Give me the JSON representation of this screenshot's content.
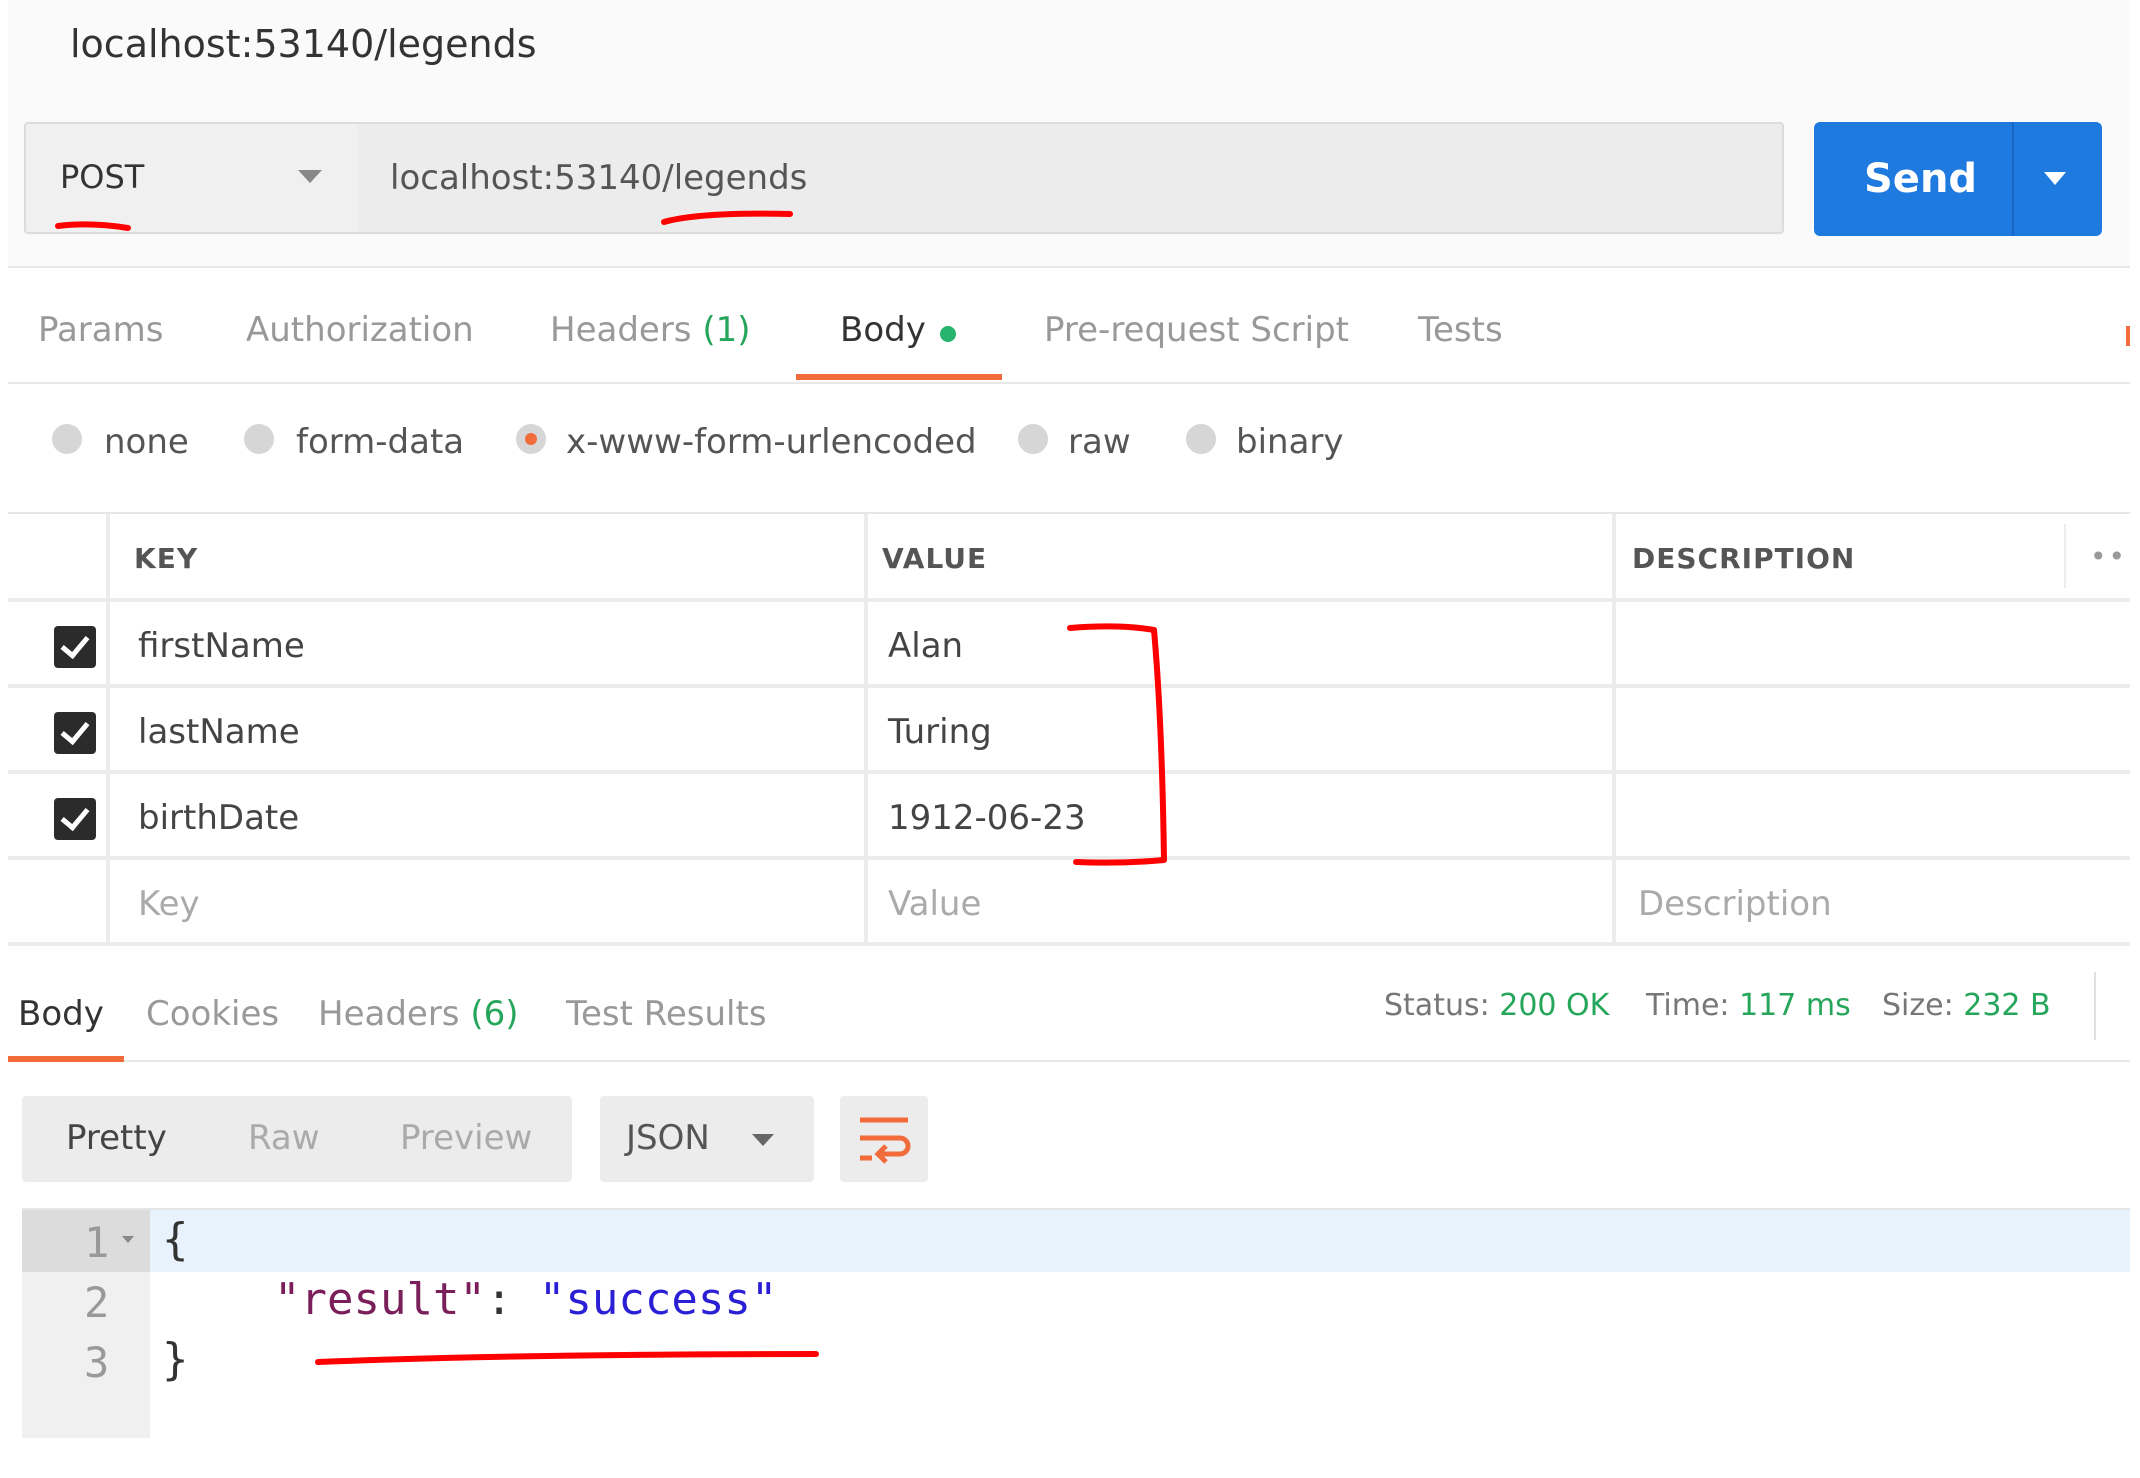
{
  "window": {
    "title": "localhost:53140/legends"
  },
  "request": {
    "method": "POST",
    "url": "localhost:53140/legends",
    "send_label": "Send"
  },
  "request_tabs": {
    "params": "Params",
    "authorization": "Authorization",
    "headers": "Headers",
    "headers_count": "(1)",
    "body": "Body",
    "pre_request": "Pre-request Script",
    "tests": "Tests"
  },
  "body_modes": [
    "none",
    "form-data",
    "x-www-form-urlencoded",
    "raw",
    "binary"
  ],
  "body_mode_selected": "x-www-form-urlencoded",
  "params_table": {
    "columns": [
      "KEY",
      "VALUE",
      "DESCRIPTION"
    ],
    "rows": [
      {
        "key": "firstName",
        "value": "Alan",
        "description": "",
        "checked": true
      },
      {
        "key": "lastName",
        "value": "Turing",
        "description": "",
        "checked": true
      },
      {
        "key": "birthDate",
        "value": "1912-06-23",
        "description": "",
        "checked": true
      }
    ],
    "placeholders": {
      "key": "Key",
      "value": "Value",
      "description": "Description"
    }
  },
  "response_tabs": {
    "body": "Body",
    "cookies": "Cookies",
    "headers": "Headers",
    "headers_count": "(6)",
    "test_results": "Test Results"
  },
  "response_status": {
    "status_label": "Status:",
    "status_value": "200 OK",
    "time_label": "Time:",
    "time_value": "117 ms",
    "size_label": "Size:",
    "size_value": "232 B"
  },
  "response_view": {
    "modes": [
      "Pretty",
      "Raw",
      "Preview"
    ],
    "selected_mode": "Pretty",
    "format": "JSON"
  },
  "response_body": {
    "line_numbers": [
      "1",
      "2",
      "3"
    ],
    "open_brace": "{",
    "key": "\"result\"",
    "colon": ": ",
    "value": "\"success\"",
    "close_brace": "}"
  },
  "colors": {
    "accent": "#f26b3a",
    "send_button": "#1f7ae0",
    "success": "#26a65b",
    "annotation": "#ff0000"
  }
}
